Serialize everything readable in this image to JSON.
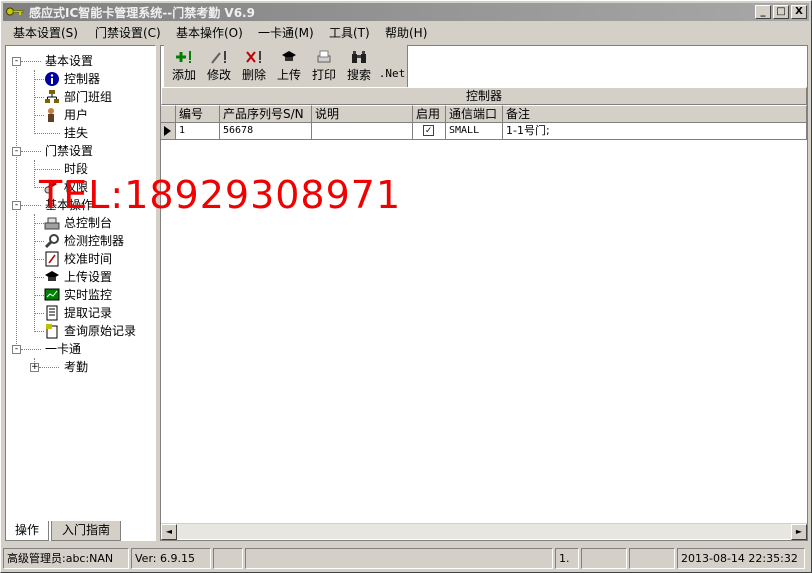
{
  "window": {
    "title": "感应式IC智能卡管理系统--门禁考勤 V6.9",
    "min_label": "_",
    "max_label": "□",
    "close_label": "X"
  },
  "menu": {
    "items": [
      {
        "label": "基本设置(S)"
      },
      {
        "label": "门禁设置(C)"
      },
      {
        "label": "基本操作(O)"
      },
      {
        "label": "一卡通(M)"
      },
      {
        "label": "工具(T)"
      },
      {
        "label": "帮助(H)"
      }
    ]
  },
  "tree": {
    "groups": [
      {
        "label": "基本设置",
        "expander": "-",
        "children": [
          {
            "label": "控制器",
            "icon": "info-icon"
          },
          {
            "label": "部门班组",
            "icon": "org-chart-icon"
          },
          {
            "label": "用户",
            "icon": "user-icon"
          },
          {
            "label": "挂失",
            "icon": ""
          }
        ]
      },
      {
        "label": "门禁设置",
        "expander": "-",
        "children": [
          {
            "label": "时段",
            "icon": ""
          },
          {
            "label": "权限",
            "icon": "key-icon"
          }
        ]
      },
      {
        "label": "基本操作",
        "expander": "-",
        "children": [
          {
            "label": "总控制台",
            "icon": "console-icon"
          },
          {
            "label": "检测控制器",
            "icon": "magnifier-icon"
          },
          {
            "label": "校准时间",
            "icon": "clock-icon"
          },
          {
            "label": "上传设置",
            "icon": "graduation-cap-icon"
          },
          {
            "label": "实时监控",
            "icon": "monitor-icon"
          },
          {
            "label": "提取记录",
            "icon": "record-icon"
          },
          {
            "label": "查询原始记录",
            "icon": "query-icon"
          }
        ]
      },
      {
        "label": "一卡通",
        "expander": "-",
        "children": [
          {
            "label": "考勤",
            "icon": "",
            "expander": "+"
          }
        ]
      }
    ]
  },
  "tabs": [
    {
      "label": "操作",
      "active": true
    },
    {
      "label": "入门指南",
      "active": false
    }
  ],
  "toolbar": {
    "buttons": [
      {
        "label": "添加",
        "icon": "add-icon"
      },
      {
        "label": "修改",
        "icon": "edit-icon"
      },
      {
        "label": "删除",
        "icon": "delete-icon"
      },
      {
        "label": "上传",
        "icon": "upload-icon"
      },
      {
        "label": "打印",
        "icon": "print-icon"
      },
      {
        "label": "搜索",
        "icon": "binoculars-icon"
      },
      {
        "label": ".Net",
        "icon": ""
      }
    ]
  },
  "grid": {
    "caption": "控制器",
    "columns": [
      "编号",
      "产品序列号S/N",
      "说明",
      "启用",
      "通信端口",
      "备注"
    ],
    "rows": [
      {
        "id": "1",
        "sn": "56678",
        "desc": "",
        "enabled": true,
        "port": "SMALL",
        "note": "1-1号门;"
      }
    ]
  },
  "scrollbar": {
    "left_arrow": "◄",
    "right_arrow": "►"
  },
  "status": {
    "user": "高级管理员:abc:NAN",
    "version": "Ver: 6.9.15",
    "field1": "",
    "field2": "",
    "field3": "",
    "field4": "1.",
    "field5": "",
    "field6": "",
    "datetime": "2013-08-14 22:35:32"
  },
  "watermark": "TEL:18929308971",
  "colors": {
    "watermark": "#f00000",
    "title_gradient_start": "#808080"
  }
}
